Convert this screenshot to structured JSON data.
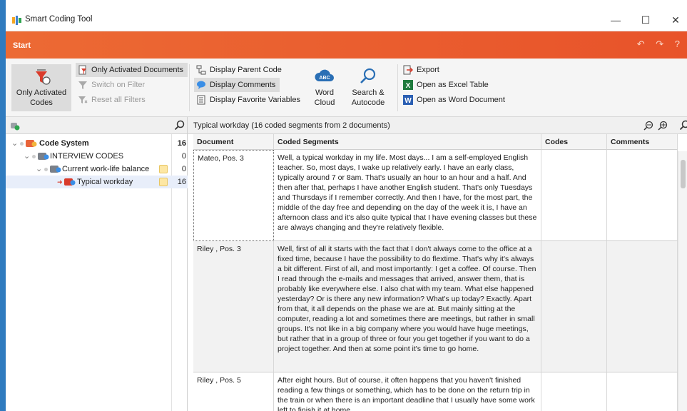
{
  "window": {
    "title": "Smart Coding Tool",
    "minimize": "—",
    "maximize": "☐",
    "close": "✕"
  },
  "ribbon_tab": "Start",
  "quick_access": "↶ ↷ ?",
  "ribbon": {
    "only_activated_codes": [
      "Only Activated",
      "Codes"
    ],
    "only_activated_documents": "Only Activated Documents",
    "switch_on_filter": "Switch on Filter",
    "reset_all_filters": "Reset all Filters",
    "display_parent_code": "Display Parent Code",
    "display_comments": "Display Comments",
    "display_favorite_variables": "Display Favorite Variables",
    "word_cloud": [
      "Word",
      "Cloud"
    ],
    "search_autocode": [
      "Search &",
      "Autocode"
    ],
    "export": "Export",
    "open_excel": "Open as Excel Table",
    "open_word": "Open as Word Document"
  },
  "code_system": {
    "root": {
      "label": "Code System",
      "count": "16"
    },
    "items": [
      {
        "label": "INTERVIEW CODES",
        "count": "0"
      },
      {
        "label": "Current work-life balance",
        "count": "0"
      },
      {
        "label": "Typical workday",
        "count": "16"
      }
    ]
  },
  "results": {
    "title": "Typical workday (16 coded segments from 2 documents)",
    "columns": [
      "Document",
      "Coded Segments",
      "Codes",
      "Comments"
    ],
    "rows": [
      {
        "document": "Mateo, Pos. 3",
        "segment": "Well, a typical workday in my life. Most days... I am a self-employed English teacher. So, most days, I wake up relatively early. I have an early class, typically around 7 or 8am. That's usually an hour to an hour and a half. And then after that, perhaps I have another English student. That's only Tuesdays and Thursdays if I remember correctly. And then I have, for the most part, the middle of the day free and depending on the day of the week it is, I have an afternoon class and it's also quite typical that I have evening classes but these are always changing and they're relatively flexible."
      },
      {
        "document": "Riley , Pos. 3",
        "segment": "Well, first of all it starts with the fact that I don't always come to the office at a fixed time, because I have the possibility to do flextime. That's why it's always a bit different. First of all, and most importantly: I get a coffee. Of course. Then I read through the e-mails and messages that arrived, answer them, that is probably like everywhere else. I also chat with my team. What else happened yesterday? Or is there any new information? What's up today? Exactly. Apart from that, it all depends on the phase we are at. But mainly sitting at the computer, reading a lot and sometimes there are meetings, but rather in small groups. It's not like in a big company where you would have huge meetings, but rather that in a group of three or four you get together if you want to do a project together. And then at some point it's time to go home."
      },
      {
        "document": "Riley , Pos. 5",
        "segment": "After eight hours. But of course, it often happens that you haven't finished reading a few things or something, which has to be done on the return trip in the train or when there is an important deadline that I usually have some work left to finish it at home."
      }
    ]
  }
}
